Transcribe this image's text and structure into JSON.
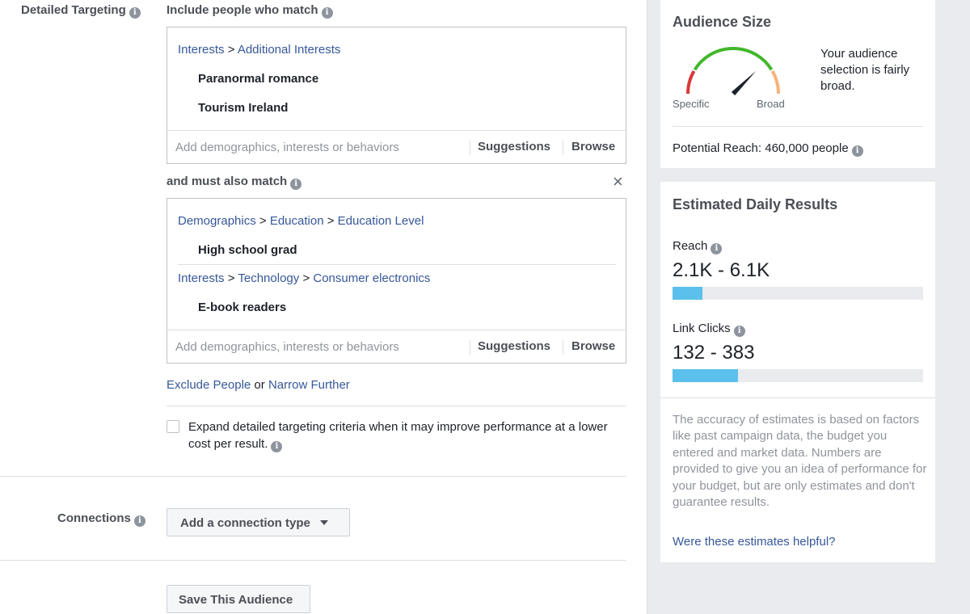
{
  "targeting": {
    "label": "Detailed Targeting",
    "include_label": "Include people who match",
    "group1": {
      "crumb": [
        {
          "text": "Interests",
          "link": true
        },
        {
          "text": ">",
          "link": false
        },
        {
          "text": "Additional Interests",
          "link": true
        }
      ],
      "items": [
        "Paranormal romance",
        "Tourism Ireland"
      ]
    },
    "input_placeholder": "Add demographics, interests or behaviors",
    "suggestions": "Suggestions",
    "browse": "Browse",
    "and_must_label": "and must also match",
    "close_glyph": "×",
    "group2a": {
      "crumb": [
        {
          "text": "Demographics",
          "link": true
        },
        {
          "text": ">",
          "link": false
        },
        {
          "text": "Education",
          "link": true
        },
        {
          "text": ">",
          "link": false
        },
        {
          "text": "Education Level",
          "link": true
        }
      ],
      "items": [
        "High school grad"
      ]
    },
    "group2b": {
      "crumb": [
        {
          "text": "Interests",
          "link": true
        },
        {
          "text": ">",
          "link": false
        },
        {
          "text": "Technology",
          "link": true
        },
        {
          "text": ">",
          "link": false
        },
        {
          "text": "Consumer electronics",
          "link": true
        }
      ],
      "items": [
        "E-book readers"
      ]
    },
    "exclude": "Exclude People",
    "or": "or",
    "narrow": "Narrow Further",
    "expand_text": "Expand detailed targeting criteria when it may improve performance at a lower cost per result.",
    "expand_checked": false
  },
  "connections": {
    "label": "Connections",
    "button": "Add a connection type"
  },
  "save_button": "Save This Audience",
  "audience": {
    "title": "Audience Size",
    "description": "Your audience selection is fairly broad.",
    "specific": "Specific",
    "broad": "Broad",
    "gauge_level": 0.75,
    "reach_text": "Potential Reach: 460,000 people"
  },
  "daily": {
    "title": "Estimated Daily Results",
    "reach_label": "Reach",
    "reach_value": "2.1K - 6.1K",
    "reach_fill": 0.12,
    "clicks_label": "Link Clicks",
    "clicks_value": "132 - 383",
    "clicks_fill": 0.26,
    "disclaimer": "The accuracy of estimates is based on factors like past campaign data, the budget you entered and market data. Numbers are provided to give you an idea of performance for your budget, but are only estimates and don't guarantee results.",
    "helpful": "Were these estimates helpful?"
  },
  "colors": {
    "accent": "#365899",
    "bar_fill": "#5bc0eb",
    "gauge_green": "#42b72a",
    "gauge_red": "#d9383a",
    "gauge_orange": "#f7b27a"
  }
}
